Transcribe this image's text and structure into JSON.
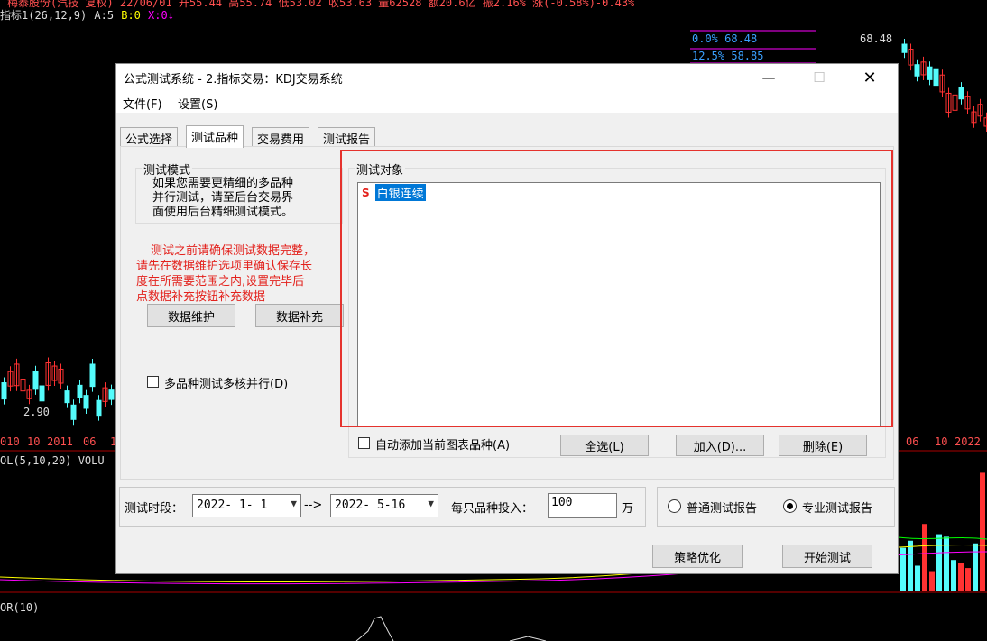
{
  "background": {
    "top_line": "梅泰股份(汽技 复权) 22/06/01 开55.44 高55.74 低53.02 收53.63 量62528 额20.6亿 振2.16% 涨(-0.58%)-0.43%",
    "indicator_label": "指标1(26,12,9)",
    "indicator_a": "A:5",
    "indicator_b": "B:0",
    "indicator_x": "X:0↓",
    "pct_line_1": "0.0% 68.48",
    "pct_line_2": "12.5% 58.85",
    "price_label_high": "68.48",
    "price_label_low": "2.90",
    "axis_left": [
      "010",
      "10",
      "2011",
      "06",
      "1"
    ],
    "axis_right": [
      "06",
      "10",
      "2022"
    ],
    "volume_label": "OL(5,10,20) VOLU",
    "bottom_label": "OR(10)"
  },
  "dialog": {
    "title": "公式测试系统 - 2.指标交易：KDJ交易系统",
    "window_buttons": {
      "minimize": "—",
      "maximize": "☐",
      "close": "✕"
    },
    "menu": [
      "文件(F)",
      "设置(S)"
    ],
    "tabs": [
      "公式选择",
      "测试品种",
      "交易费用",
      "测试报告"
    ],
    "active_tab": "测试品种",
    "test_mode": {
      "legend": "测试模式",
      "lines": [
        "如果您需要更精细的多品种",
        "并行测试，请至后台交易界",
        "面使用后台精细测试模式。"
      ]
    },
    "warning_lines": [
      "测试之前请确保测试数据完整，",
      "请先在数据维护选项里确认保存长",
      "度在所需要范围之内,设置完毕后",
      "点数据补充按钮补充数据"
    ],
    "data_maintain_button": "数据维护",
    "data_supplement_button": "数据补充",
    "multicore_checkbox": {
      "label": "多品种测试多核并行(D)",
      "checked": false
    },
    "test_objects": {
      "legend": "测试对象",
      "items": [
        {
          "prefix": "S",
          "name": "白银连续",
          "selected": true
        }
      ]
    },
    "auto_add_checkbox": {
      "label": "自动添加当前图表品种(A)",
      "checked": false
    },
    "select_all_button": "全选(L)",
    "add_button": "加入(D)...",
    "delete_button": "删除(E)",
    "period": {
      "label": "测试时段：",
      "start": "2022- 1- 1",
      "arrow": "-->",
      "end": "2022- 5-16"
    },
    "investment": {
      "label": "每只品种投入：",
      "value": "100",
      "unit": "万"
    },
    "report_type": {
      "options": [
        "普通测试报告",
        "专业测试报告"
      ],
      "selected": "专业测试报告"
    },
    "optimize_button": "策略优化",
    "start_button": "开始测试"
  },
  "colors": {
    "highlight_frame": "#e5322d",
    "warning_text": "#e3211c",
    "selection": "#0078d7",
    "chart_up": "#ff3232",
    "chart_down": "#54fcfc"
  }
}
